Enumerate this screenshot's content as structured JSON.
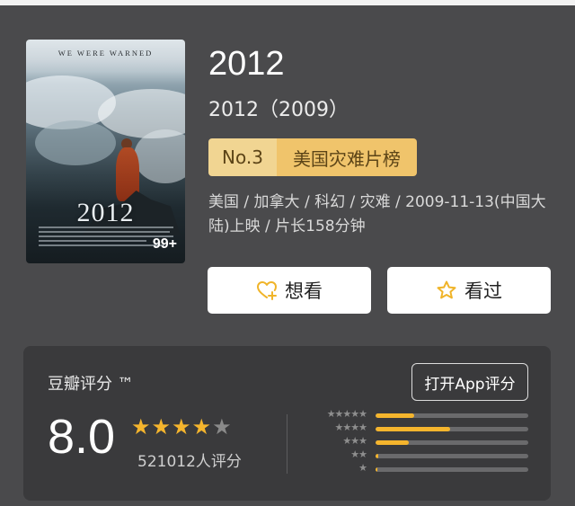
{
  "poster": {
    "tagline": "WE WERE WARNED",
    "title": "2012",
    "badge": "99+"
  },
  "movie": {
    "title": "2012",
    "subtitle": "2012（2009）",
    "rank_no": "No.3",
    "rank_name": "美国灾难片榜",
    "meta": "美国 / 加拿大 / 科幻 / 灾难 / 2009-11-13(中国大陆)上映 / 片长158分钟"
  },
  "actions": {
    "want_label": "想看",
    "seen_label": "看过"
  },
  "rating": {
    "label": "豆瓣评分 ™",
    "open_app": "打开App评分",
    "score": "8.0",
    "stars_full": 4,
    "stars_total": 5,
    "count": "521012人评分",
    "distribution": [
      {
        "stars": "★★★★★",
        "fraction": 0.25
      },
      {
        "stars": "★★★★",
        "fraction": 0.49
      },
      {
        "stars": "★★★",
        "fraction": 0.22
      },
      {
        "stars": "★★",
        "fraction": 0.02
      },
      {
        "stars": "★",
        "fraction": 0.01
      }
    ]
  },
  "colors": {
    "background": "#4a4a4c",
    "card": "#3a3a3c",
    "accent_star": "#f5b52d",
    "rank_badge_light": "#f1d592",
    "rank_badge_dark": "#f0c46b"
  },
  "icons": {
    "want": "heart-plus-icon",
    "seen": "star-outline-icon"
  }
}
